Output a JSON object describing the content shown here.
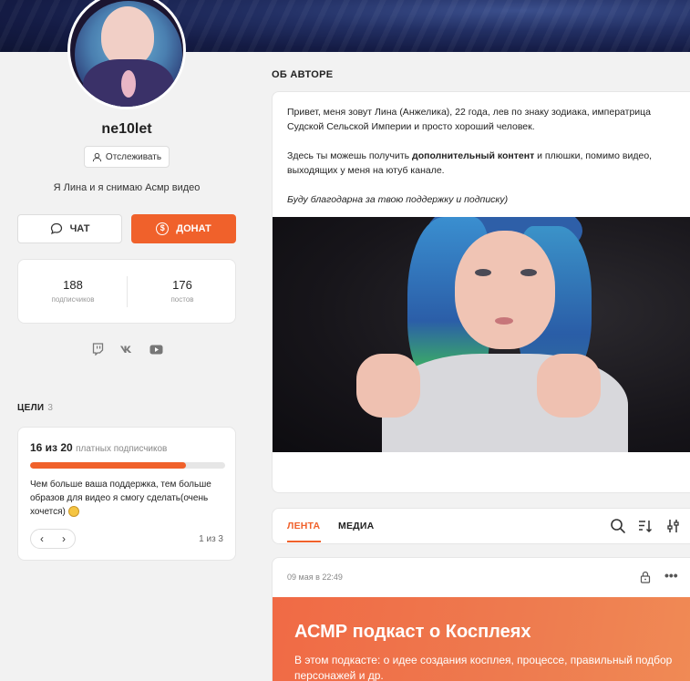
{
  "profile": {
    "username": "ne10let",
    "follow_label": "Отслеживать",
    "bio": "Я Лина и я снимаю Асмр видео",
    "chat_label": "ЧАТ",
    "donate_label": "ДОНАТ",
    "subscribers_count": "188",
    "subscribers_label": "подписчиков",
    "posts_count": "176",
    "posts_label": "постов",
    "socials": [
      "twitch-icon",
      "vk-icon",
      "youtube-icon"
    ]
  },
  "goals": {
    "title": "ЦЕЛИ",
    "count": "3",
    "current": "16 из 20",
    "unit": "платных подписчиков",
    "progress": 0.8,
    "description": "Чем больше ваша поддержка, тем больше образов для видео я смогу сделать(очень хочется)",
    "prev": "‹",
    "next": "›",
    "page": "1 из 3"
  },
  "about": {
    "title": "ОБ АВТОРЕ",
    "p1": "Привет, меня зовут Лина (Анжелика), 22 года, лев по знаку зодиака, императрица Судской Сельской Империи и просто хороший человек.",
    "p2_before": "Здесь ты можешь получить ",
    "p2_bold": "дополнительный контент",
    "p2_after": " и плюшки, помимо видео, выходящих у меня на ютуб канале.",
    "p3": "Буду благодарна за твою поддержку и подписку)"
  },
  "feed": {
    "tabs": [
      "ЛЕНТА",
      "МЕДИА"
    ],
    "active_tab": "ЛЕНТА"
  },
  "post": {
    "date": "09 мая в 22:49",
    "more": "•••",
    "title": "АСМР подкаст о Косплеях",
    "subtitle": "В этом подкасте: о идее создания косплея, процессе, правильный подбор персонажей и др."
  },
  "colors": {
    "accent": "#f0612b",
    "banner": "#1a2350",
    "background": "#f2f2f2"
  }
}
